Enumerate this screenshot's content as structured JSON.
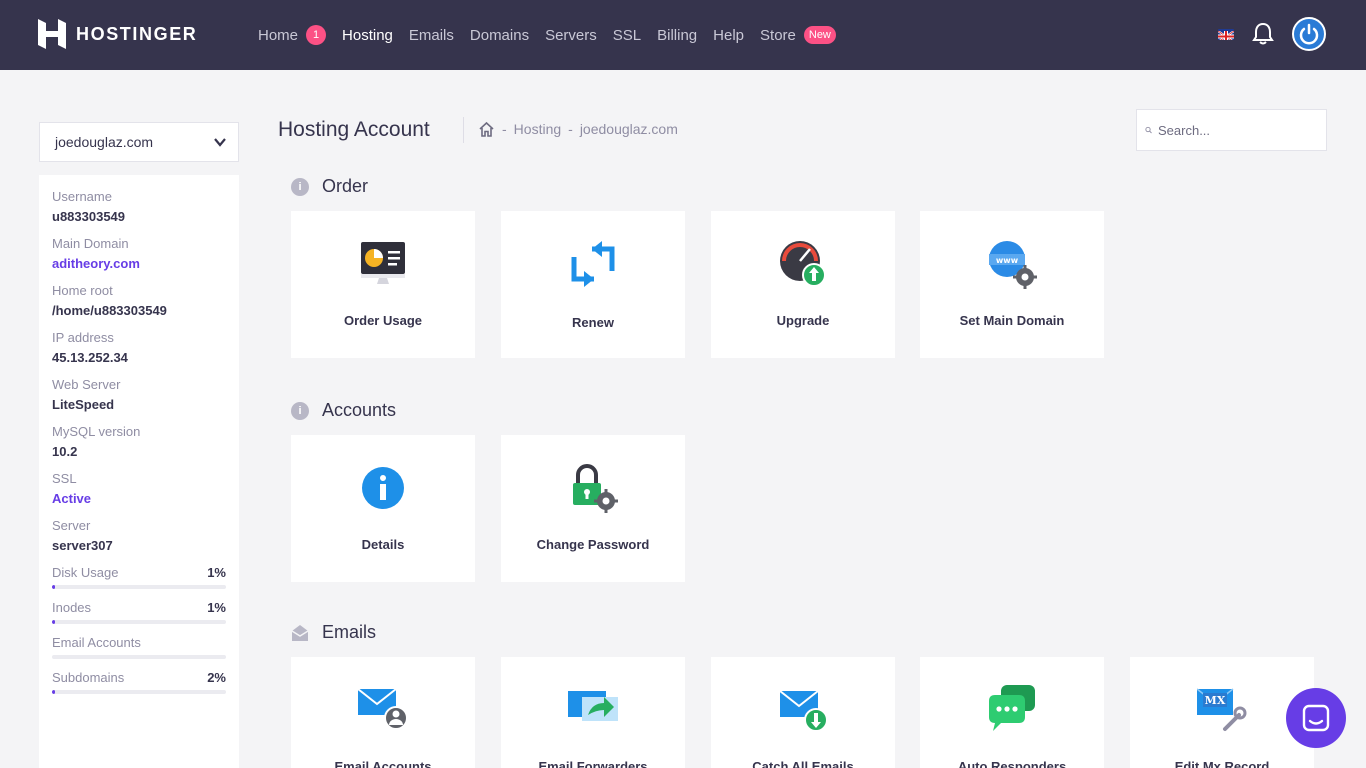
{
  "brand": {
    "name": "HOSTINGER"
  },
  "nav": {
    "items": [
      {
        "label": "Home",
        "badge": "1"
      },
      {
        "label": "Hosting"
      },
      {
        "label": "Emails"
      },
      {
        "label": "Domains"
      },
      {
        "label": "Servers"
      },
      {
        "label": "SSL"
      },
      {
        "label": "Billing"
      },
      {
        "label": "Help"
      },
      {
        "label": "Store",
        "badge": "New"
      }
    ]
  },
  "sidebar": {
    "selected_domain": "joedouglaz.com",
    "info": [
      {
        "label": "Username",
        "value": "u883303549"
      },
      {
        "label": "Main Domain",
        "value": "aditheory.com"
      },
      {
        "label": "Home root",
        "value": "/home/u883303549"
      },
      {
        "label": "IP address",
        "value": "45.13.252.34"
      },
      {
        "label": "Web Server",
        "value": "LiteSpeed"
      },
      {
        "label": "MySQL version",
        "value": "10.2"
      },
      {
        "label": "SSL",
        "value": "Active"
      },
      {
        "label": "Server",
        "value": "server307"
      }
    ],
    "usage": [
      {
        "label": "Disk Usage",
        "value": "1%",
        "fraction": 0.01
      },
      {
        "label": "Inodes",
        "value": "1%",
        "fraction": 0.01
      },
      {
        "label": "Email Accounts",
        "value": "",
        "fraction": 0
      },
      {
        "label": "Subdomains",
        "value": "2%",
        "fraction": 0.02
      }
    ]
  },
  "header": {
    "title": "Hosting Account",
    "breadcrumb": [
      "Hosting",
      "joedouglaz.com"
    ],
    "separator": "-",
    "search_placeholder": "Search..."
  },
  "sections": {
    "order": {
      "title": "Order",
      "tiles": [
        {
          "label": "Order Usage",
          "icon": "usage-chart-icon"
        },
        {
          "label": "Renew",
          "icon": "renew-icon"
        },
        {
          "label": "Upgrade",
          "icon": "gauge-upgrade-icon"
        },
        {
          "label": "Set Main Domain",
          "icon": "globe-gear-icon"
        }
      ]
    },
    "accounts": {
      "title": "Accounts",
      "tiles": [
        {
          "label": "Details",
          "icon": "info-circle-icon"
        },
        {
          "label": "Change Password",
          "icon": "lock-gear-icon"
        }
      ]
    },
    "emails": {
      "title": "Emails",
      "tiles": [
        {
          "label": "Email Accounts",
          "icon": "mail-user-icon"
        },
        {
          "label": "Email Forwarders",
          "icon": "mail-forward-icon"
        },
        {
          "label": "Catch All Emails",
          "icon": "mail-download-icon"
        },
        {
          "label": "Auto Responders",
          "icon": "chat-bubbles-icon"
        },
        {
          "label": "Edit Mx Record",
          "icon": "mx-wrench-icon"
        }
      ]
    }
  },
  "colors": {
    "nav_bg": "#36344d",
    "accent": "#673de6",
    "badge": "#fc5185"
  }
}
